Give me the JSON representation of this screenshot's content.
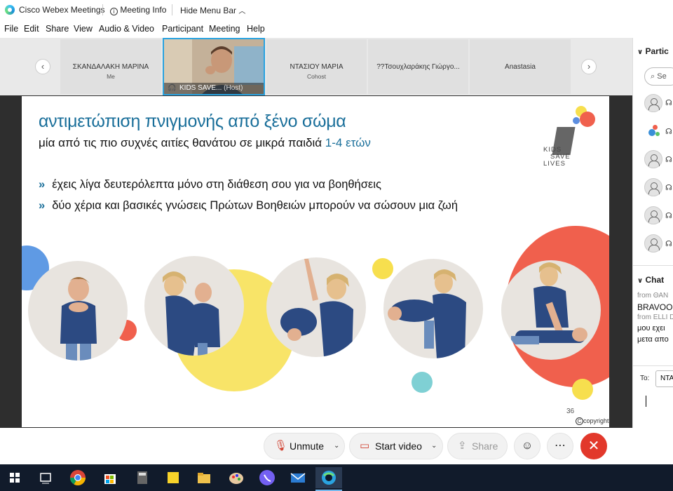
{
  "titlebar": {
    "app": "Cisco Webex Meetings",
    "meeting_info": "Meeting Info",
    "hide_menu": "Hide Menu Bar",
    "info_icon": "info-icon",
    "chevron_icon": "chevron-up-icon"
  },
  "menu": [
    "File",
    "Edit",
    "Share",
    "View",
    "Audio & Video",
    "Participant",
    "Meeting",
    "Help"
  ],
  "strip": {
    "tiles": [
      {
        "name": "ΣΚΑΝΔΑΛΑΚΗ ΜΑΡΙΝΑ",
        "sub": "Me"
      },
      {
        "name": "ΝΤΑΣΙΟΥ ΜΑΡΙΑ",
        "sub": "Cohost"
      },
      {
        "name": "??Τσουχλαράκης Γιώργο...",
        "sub": ""
      },
      {
        "name": "Anastasia",
        "sub": ""
      }
    ],
    "host": {
      "name": "KIDS SAVE...",
      "role": "(Host)"
    }
  },
  "slide": {
    "title": "αντιμετώπιση πνιγμονής από ξένο σώμα",
    "subtitle": "μία από τις πιο συχνές αιτίες θανάτου σε μικρά παιδιά",
    "age": "1-4 ετών",
    "bullets": [
      "έχεις λίγα δευτερόλεπτα μόνο στη διάθεση σου για να βοηθήσεις",
      "δύο χέρια και βασικές γνώσεις Πρώτων Βοηθειών μπορούν να σώσουν μια ζωή"
    ],
    "bullet_marker": "»",
    "logo": [
      "KIDS",
      "SAVE",
      "LIVES"
    ],
    "page": "36",
    "copyright": "copyright"
  },
  "panel": {
    "participants_title": "Partic",
    "search_placeholder": "Se",
    "chat_title": "Chat",
    "chat_lines": [
      "from ΘΑΝ",
      "BRAVOO",
      "from ELLI D",
      "μου εχει",
      "μετα απο"
    ],
    "to_label": "To:",
    "to_value": "ΝΤΑ"
  },
  "controls": {
    "unmute": "Unmute",
    "start_video": "Start video",
    "share": "Share"
  },
  "colors": {
    "accent": "#2aa3e0",
    "slide_blue": "#1a6f9a",
    "end_red": "#e2382b",
    "yellow": "#f7df4e",
    "coral": "#f0604d"
  }
}
